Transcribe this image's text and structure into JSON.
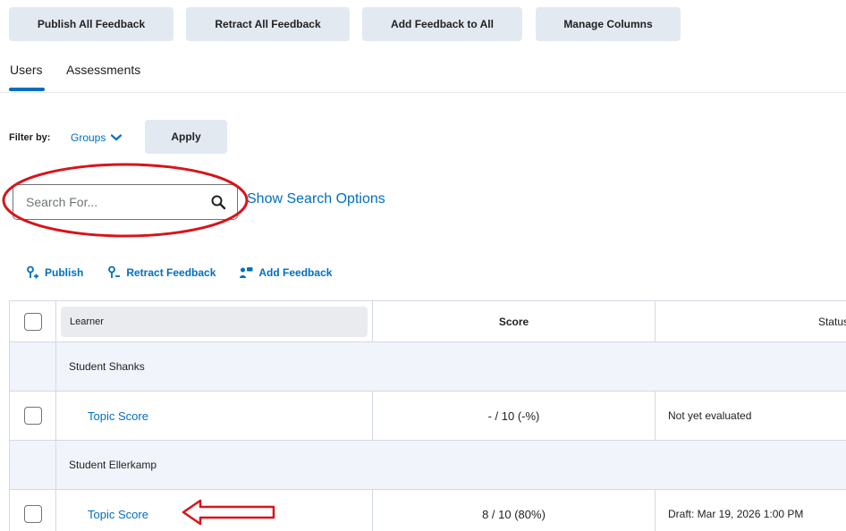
{
  "toolbar": {
    "publish_all": "Publish All Feedback",
    "retract_all": "Retract All Feedback",
    "add_all": "Add Feedback to All",
    "manage_columns": "Manage Columns"
  },
  "tabs": [
    {
      "label": "Users",
      "active": true
    },
    {
      "label": "Assessments",
      "active": false
    }
  ],
  "filter": {
    "label": "Filter by:",
    "selected": "Groups",
    "apply_label": "Apply"
  },
  "search": {
    "placeholder": "Search For...",
    "value": "",
    "options_link": "Show Search Options"
  },
  "actions": {
    "publish": "Publish",
    "retract": "Retract Feedback",
    "add": "Add Feedback"
  },
  "table": {
    "headers": {
      "learner": "Learner",
      "score": "Score",
      "status": "Status"
    },
    "groups": [
      {
        "name": "Student Shanks",
        "item": {
          "link": "Topic Score",
          "score": "- / 10 (-%)",
          "status": "Not yet evaluated"
        }
      },
      {
        "name": "Student Ellerkamp",
        "item": {
          "link": "Topic Score",
          "score": "8 / 10 (80%)",
          "status": "Draft: Mar 19, 2026 1:00 PM"
        }
      }
    ]
  },
  "colors": {
    "accent": "#006fbf",
    "button_bg": "#e3e9f1",
    "annotation": "#d7141a"
  }
}
